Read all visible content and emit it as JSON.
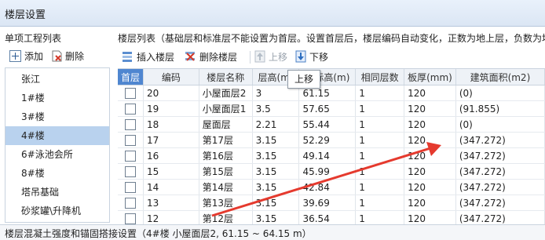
{
  "window": {
    "title": "楼层设置"
  },
  "left": {
    "title": "单项工程列表",
    "add_label": "添加",
    "delete_label": "删除",
    "items": [
      {
        "label": "张江"
      },
      {
        "label": "1#楼"
      },
      {
        "label": "3#楼"
      },
      {
        "label": "4#楼"
      },
      {
        "label": "6#泳池会所"
      },
      {
        "label": "8#楼"
      },
      {
        "label": "塔吊基础"
      },
      {
        "label": "砂浆罐\\升降机"
      }
    ],
    "selected_index": 3
  },
  "right": {
    "note": "楼层列表（基础层和标准层不能设置为首层。设置首层后，楼层编码自动变化，正数为地上层，负数为地",
    "toolbar": {
      "insert_label": "插入楼层",
      "delete_label": "删除楼层",
      "up_label": "上移",
      "down_label": "下移"
    },
    "tooltip": "上移",
    "columns": [
      "首层",
      "编码",
      "楼层名称",
      "层高(m)",
      "底标高(m)",
      "相同层数",
      "板厚(mm)",
      "建筑面积(m2)"
    ],
    "rows": [
      {
        "code": "20",
        "name": "小屋面层2",
        "height": "3",
        "elev": "61.15",
        "same": "1",
        "thick": "120",
        "area": "(0)"
      },
      {
        "code": "19",
        "name": "小屋面层1",
        "height": "3.5",
        "elev": "57.65",
        "same": "1",
        "thick": "120",
        "area": "(91.855)"
      },
      {
        "code": "18",
        "name": "屋面层",
        "height": "2.21",
        "elev": "55.44",
        "same": "1",
        "thick": "120",
        "area": "(0)"
      },
      {
        "code": "17",
        "name": "第17层",
        "height": "3.15",
        "elev": "52.29",
        "same": "1",
        "thick": "120",
        "area": "(347.272)"
      },
      {
        "code": "16",
        "name": "第16层",
        "height": "3.15",
        "elev": "49.14",
        "same": "1",
        "thick": "120",
        "area": "(347.272)"
      },
      {
        "code": "15",
        "name": "第15层",
        "height": "3.15",
        "elev": "45.99",
        "same": "1",
        "thick": "120",
        "area": "(347.272)"
      },
      {
        "code": "14",
        "name": "第14层",
        "height": "3.15",
        "elev": "42.84",
        "same": "1",
        "thick": "120",
        "area": "(347.272)"
      },
      {
        "code": "13",
        "name": "第13层",
        "height": "3.15",
        "elev": "39.69",
        "same": "1",
        "thick": "120",
        "area": "(347.272)"
      },
      {
        "code": "12",
        "name": "第12层",
        "height": "3.15",
        "elev": "36.54",
        "same": "1",
        "thick": "120",
        "area": "(347.272)"
      }
    ]
  },
  "status": {
    "text": "楼层混凝土强度和锚固搭接设置（4#楼  小屋面层2, 61.15 ~ 64.15 m）"
  },
  "colors": {
    "header_accent": "#4f86d0",
    "selection": "#b9d2ee",
    "annotation_arrow": "#e53a2e"
  },
  "icons": [
    "plus-icon",
    "delete-icon",
    "insert-floor-icon",
    "delete-floor-icon",
    "move-up-icon",
    "move-down-icon",
    "annotation-arrow"
  ]
}
